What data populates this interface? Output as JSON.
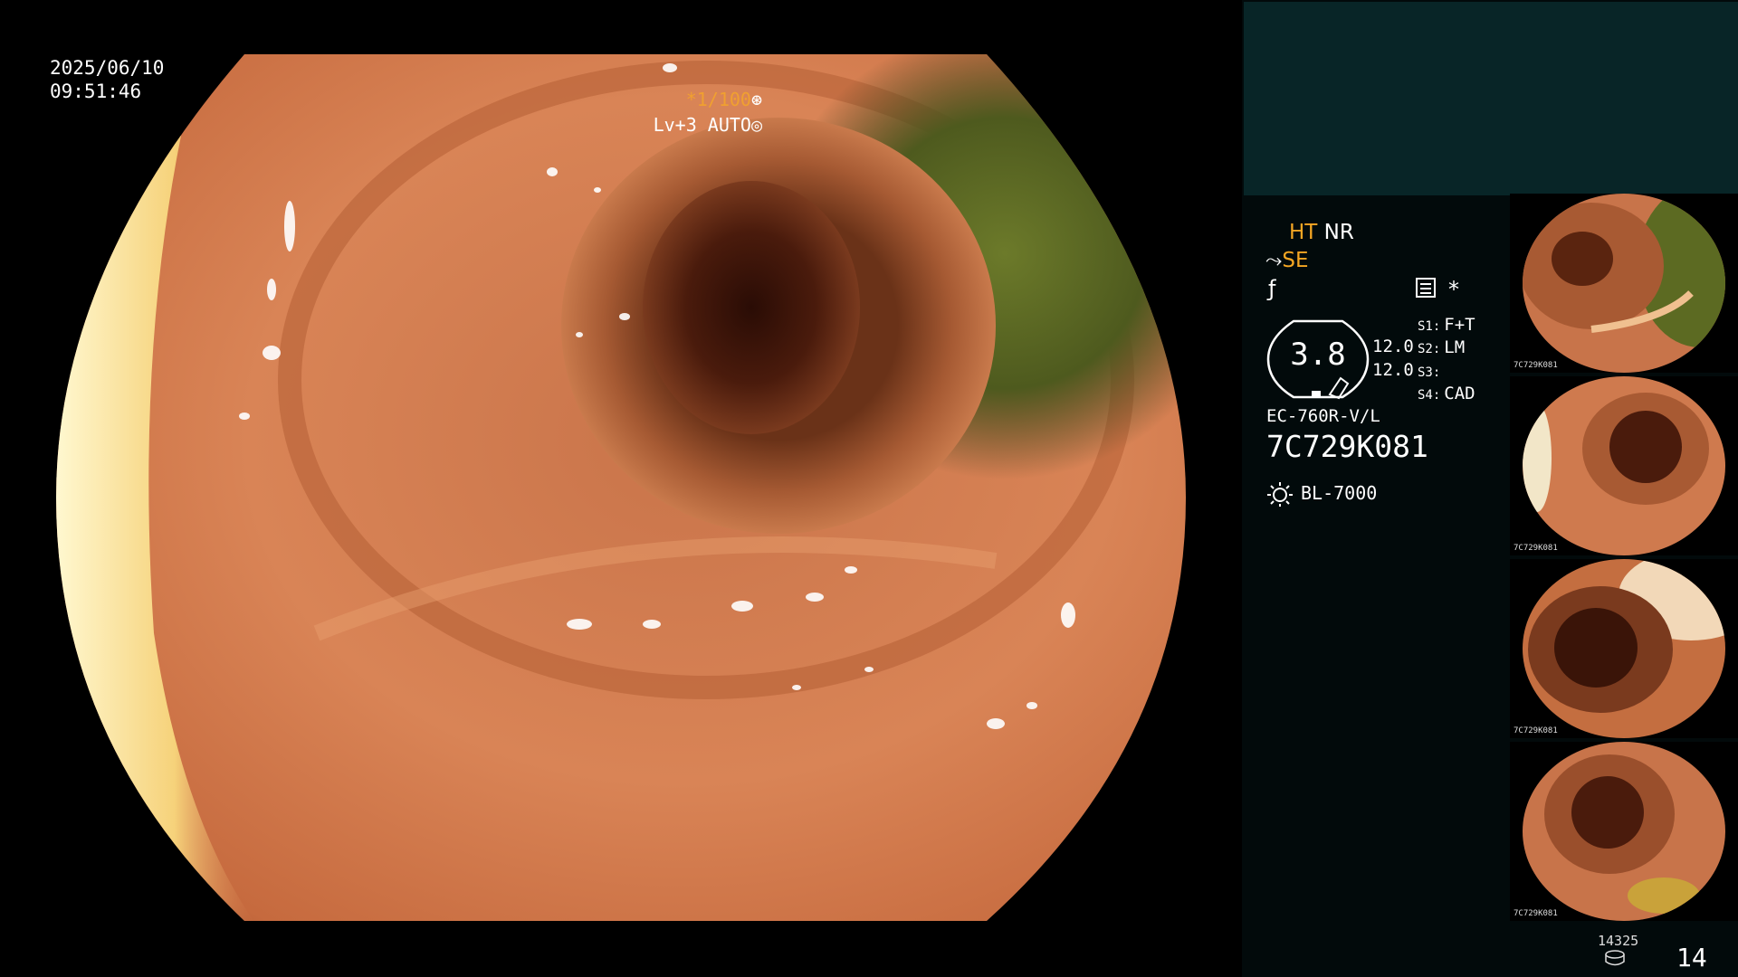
{
  "overlay": {
    "date": "2025/06/10",
    "time": "09:51:46",
    "shutter_speed": "*1/100",
    "level": "Lv+3 AUTO"
  },
  "panel": {
    "ht": "HT",
    "nr": "NR",
    "se": "SE",
    "dial_value": "3.8",
    "value_1": "12.0",
    "value_2": "12.0",
    "s1_key": "S1:",
    "s1_value": "F+T",
    "s2_key": "S2:",
    "s2_value": "LM",
    "s3_key": "S3:",
    "s3_value": "",
    "s4_key": "S4:",
    "s4_value": "CAD",
    "scope_model": "EC-760R-V/L",
    "scope_serial": "7C729K081",
    "light_source": "BL-7000",
    "image_count_small": "14325",
    "image_count": "14"
  },
  "thumbnails": [
    {
      "label": "7C729K081"
    },
    {
      "label": "7C729K081"
    },
    {
      "label": "7C729K081"
    },
    {
      "label": "7C729K081"
    }
  ],
  "colors": {
    "osd_orange": "#f5a623",
    "panel_bg": "#020a0b",
    "panel_header_bg": "#082527",
    "mucosa": "#d27a4c"
  },
  "icons": [
    "shutter-icon",
    "auto-iris-icon",
    "structure-enhance-icon",
    "f-mode-icon",
    "menu-mode-icon",
    "light-source-icon",
    "storage-icon"
  ]
}
